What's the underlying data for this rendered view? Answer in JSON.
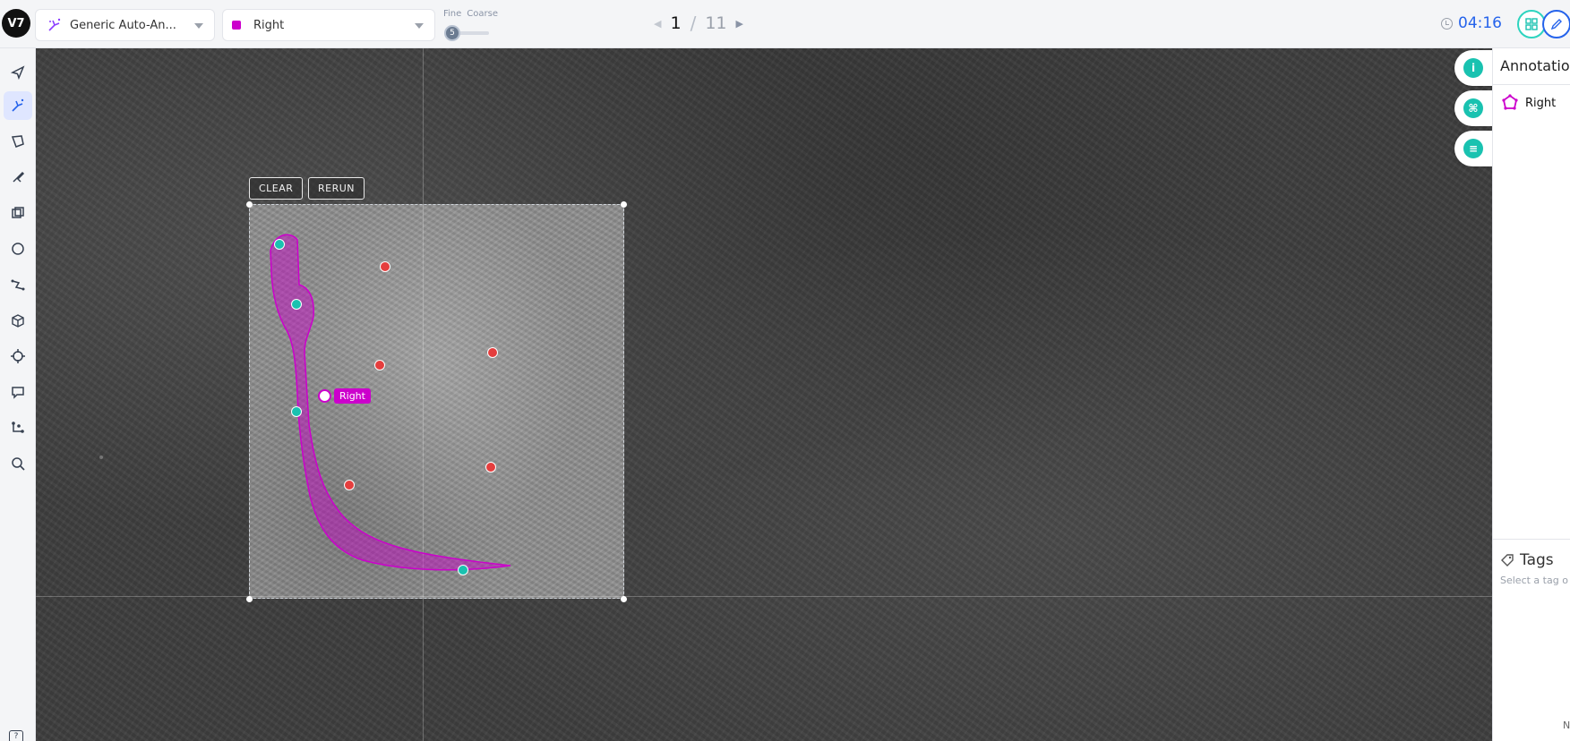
{
  "app": {
    "logo_text": "V7"
  },
  "toolbar": {
    "model_dropdown_label": "Generic Auto-An...",
    "class_dropdown_label": "Right",
    "class_color": "#cc00cc",
    "granularity": {
      "fine_label": "Fine",
      "coarse_label": "Coarse",
      "value": "5"
    },
    "pager": {
      "current": "1",
      "separator": "/",
      "total": "11"
    },
    "timer": "04:16"
  },
  "left_tools": [
    "select-tool-icon",
    "auto-annotate-tool-icon",
    "polygon-tool-icon",
    "brush-tool-icon",
    "bounding-box-tool-icon",
    "ellipse-tool-icon",
    "polyline-tool-icon",
    "cuboid-tool-icon",
    "keypoint-tool-icon",
    "comment-tool-icon",
    "skeleton-tool-icon",
    "zoom-tool-icon"
  ],
  "canvas": {
    "clear_label": "CLEAR",
    "rerun_label": "RERUN",
    "annotation_label": "Right",
    "positive_points": 4,
    "negative_points": 5
  },
  "right_panel": {
    "title": "Annotation",
    "annotation_item": "Right",
    "tags_title": "Tags",
    "tags_placeholder": "Select a tag o",
    "corner_text": "N"
  },
  "colors": {
    "accent": "#2563eb",
    "positive_point": "#19c2b0",
    "negative_point": "#e53e3e",
    "annotation": "#cc00cc"
  }
}
